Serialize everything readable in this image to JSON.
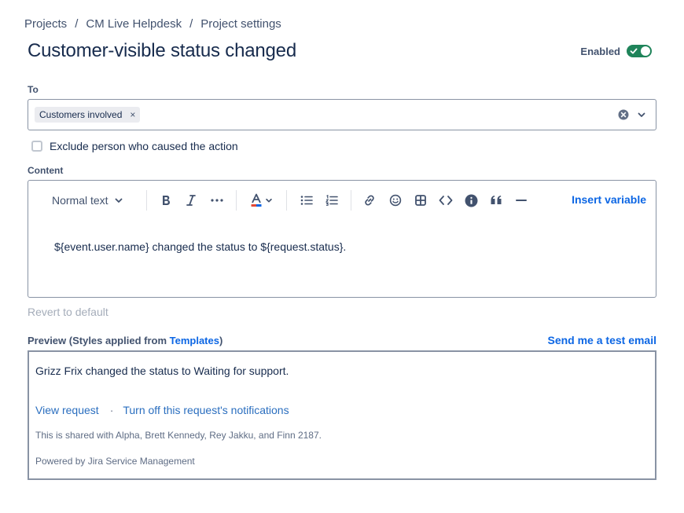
{
  "breadcrumb": {
    "items": [
      "Projects",
      "CM Live Helpdesk",
      "Project settings"
    ],
    "separator": "/"
  },
  "page": {
    "title": "Customer-visible status changed",
    "enabled_label": "Enabled",
    "enabled": true
  },
  "to_field": {
    "label": "To",
    "tags": [
      "Customers involved"
    ],
    "tag_remove": "×",
    "clear_icon": "clear-icon",
    "dropdown_icon": "chevron-down-icon"
  },
  "exclude": {
    "label": "Exclude person who caused the action",
    "checked": false
  },
  "content": {
    "label": "Content",
    "toolbar": {
      "text_style": "Normal text",
      "buttons": [
        "bold-icon",
        "italic-icon",
        "more-icon",
        "text-color-icon",
        "bullet-list-icon",
        "numbered-list-icon",
        "link-icon",
        "emoji-icon",
        "table-icon",
        "code-icon",
        "info-icon",
        "quote-icon",
        "divider-icon"
      ],
      "insert_variable": "Insert variable"
    },
    "body": "${event.user.name} changed the status to ${request.status}."
  },
  "revert_label": "Revert to default",
  "preview": {
    "label_prefix": "Preview (Styles applied from ",
    "label_link": "Templates",
    "label_suffix": ")",
    "send_test": "Send me a test email",
    "message": "Grizz Frix changed the status to Waiting for support.",
    "view_request": "View request",
    "dot": "·",
    "turn_off": "Turn off this request's notifications",
    "shared": "This is shared with Alpha, Brett Kennedy, Rey Jakku, and Finn 2187.",
    "powered": "Powered by Jira Service Management"
  },
  "colors": {
    "accent": "#0c66e4",
    "toggle_on": "#1f845a",
    "text_color_bar": "#e34935"
  }
}
